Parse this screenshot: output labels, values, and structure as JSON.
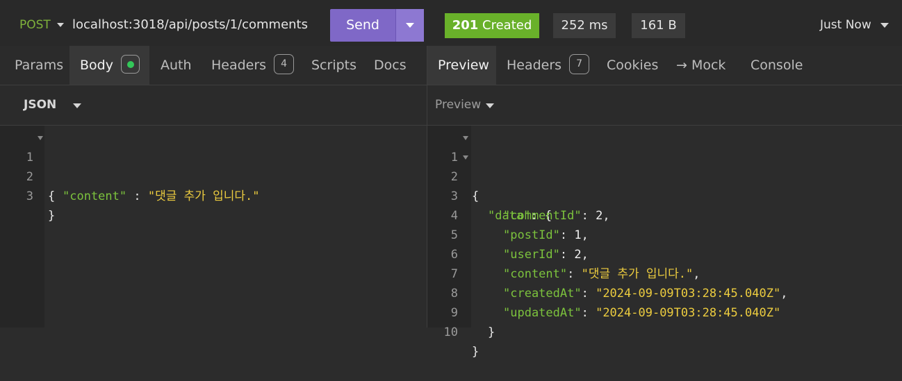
{
  "request": {
    "method": "POST",
    "url": "localhost:3018/api/posts/1/comments",
    "send_label": "Send"
  },
  "response": {
    "status_code": "201",
    "status_text": "Created",
    "time": "252 ms",
    "size": "161 B",
    "history": "Just Now"
  },
  "request_tabs": {
    "params": "Params",
    "body": "Body",
    "auth": "Auth",
    "headers": "Headers",
    "headers_count": "4",
    "scripts": "Scripts",
    "docs": "Docs"
  },
  "response_tabs": {
    "preview": "Preview",
    "headers": "Headers",
    "headers_count": "7",
    "cookies": "Cookies",
    "mock": "→ Mock",
    "console": "Console"
  },
  "body_format": "JSON",
  "preview_mode": "Preview",
  "request_body": {
    "line_numbers": [
      "1",
      "2",
      "3"
    ],
    "open": "{",
    "key": "\"content\"",
    "sep": " : ",
    "value": "\"댓글 추가 입니다.\"",
    "close": "}"
  },
  "response_body": {
    "line_numbers": [
      "1",
      "2",
      "3",
      "4",
      "5",
      "6",
      "7",
      "8",
      "9",
      "10"
    ],
    "open": "{",
    "data_key": "\"data\"",
    "data_open": ": {",
    "fields": [
      {
        "key": "\"commentId\"",
        "value": "2",
        "type": "number",
        "trail": ","
      },
      {
        "key": "\"postId\"",
        "value": "1",
        "type": "number",
        "trail": ","
      },
      {
        "key": "\"userId\"",
        "value": "2",
        "type": "number",
        "trail": ","
      },
      {
        "key": "\"content\"",
        "value": "\"댓글 추가 입니다.\"",
        "type": "string",
        "trail": ","
      },
      {
        "key": "\"createdAt\"",
        "value": "\"2024-09-09T03:28:45.040Z\"",
        "type": "string",
        "trail": ","
      },
      {
        "key": "\"updatedAt\"",
        "value": "\"2024-09-09T03:28:45.040Z\"",
        "type": "string",
        "trail": ""
      }
    ],
    "data_close": "}",
    "close": "}"
  },
  "colors": {
    "method": "#7fb23b",
    "send_button": "#7f68c7",
    "status_ok": "#69b12a",
    "json_key": "#7cc23d",
    "json_string": "#eccc3f",
    "active_dot": "#33c759"
  },
  "icons": [
    "chevron-down-icon",
    "fold-arrow-icon",
    "active-dot-icon"
  ]
}
